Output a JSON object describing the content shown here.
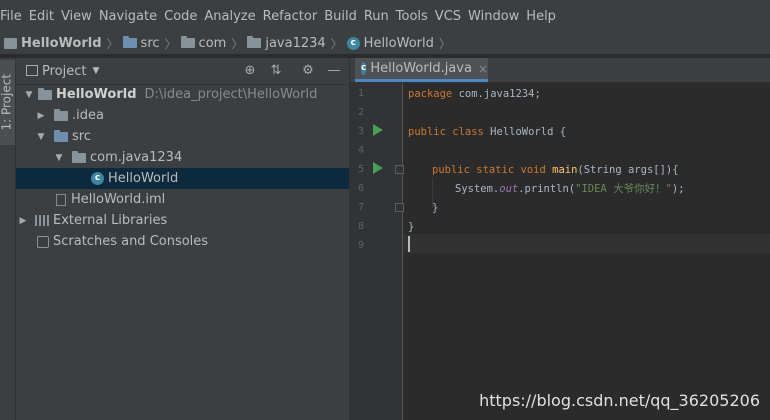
{
  "menu": [
    "File",
    "Edit",
    "View",
    "Navigate",
    "Code",
    "Analyze",
    "Refactor",
    "Build",
    "Run",
    "Tools",
    "VCS",
    "Window",
    "Help"
  ],
  "breadcrumb": [
    {
      "label": "HelloWorld",
      "icon": "project-icon"
    },
    {
      "label": "src",
      "icon": "folder-icon"
    },
    {
      "label": "com",
      "icon": "package-icon"
    },
    {
      "label": "java1234",
      "icon": "package-icon"
    },
    {
      "label": "HelloWorld",
      "icon": "java-class-icon"
    }
  ],
  "tool_window": {
    "stripe_label": "1: Project",
    "title": "Project"
  },
  "tree": [
    {
      "label": "HelloWorld",
      "path": "D:\\idea_project\\HelloWorld",
      "expanded": "down",
      "icon": "project-folder-icon"
    },
    {
      "label": ".idea",
      "expanded": "right",
      "icon": "folder-icon"
    },
    {
      "label": "src",
      "expanded": "down",
      "icon": "source-folder-icon"
    },
    {
      "label": "com.java1234",
      "expanded": "down",
      "icon": "package-icon"
    },
    {
      "label": "HelloWorld",
      "icon": "java-class-icon",
      "selected": true
    },
    {
      "label": "HelloWorld.iml",
      "icon": "iml-file-icon"
    },
    {
      "label": "External Libraries",
      "expanded": "right",
      "icon": "library-icon"
    },
    {
      "label": "Scratches and Consoles",
      "icon": "scratches-icon"
    }
  ],
  "editor": {
    "tab": {
      "label": "HelloWorld.java",
      "close": "×"
    },
    "line_numbers": [
      "1",
      "2",
      "3",
      "4",
      "5",
      "6",
      "7",
      "8",
      "9"
    ],
    "code": {
      "line1": {
        "kw": "package",
        "rest": " com.java1234;"
      },
      "line3": {
        "kw": "public class",
        "name": " HelloWorld {"
      },
      "line5": {
        "kw": "public static void",
        "fn": " main",
        "rest": "(String args[]){"
      },
      "line6": {
        "pre": "System.",
        "field": "out",
        "mid": ".println(",
        "str": "\"IDEA 大爷你好！\"",
        "end": ");"
      },
      "line7": "}",
      "line8": "}"
    }
  },
  "watermark": "https://blog.csdn.net/qq_36205206",
  "colors": {
    "keyword": "#cc7832",
    "method": "#ffc66d",
    "string": "#6a8759",
    "field": "#9876aa",
    "selection": "#0d293e",
    "run": "#499c54"
  }
}
